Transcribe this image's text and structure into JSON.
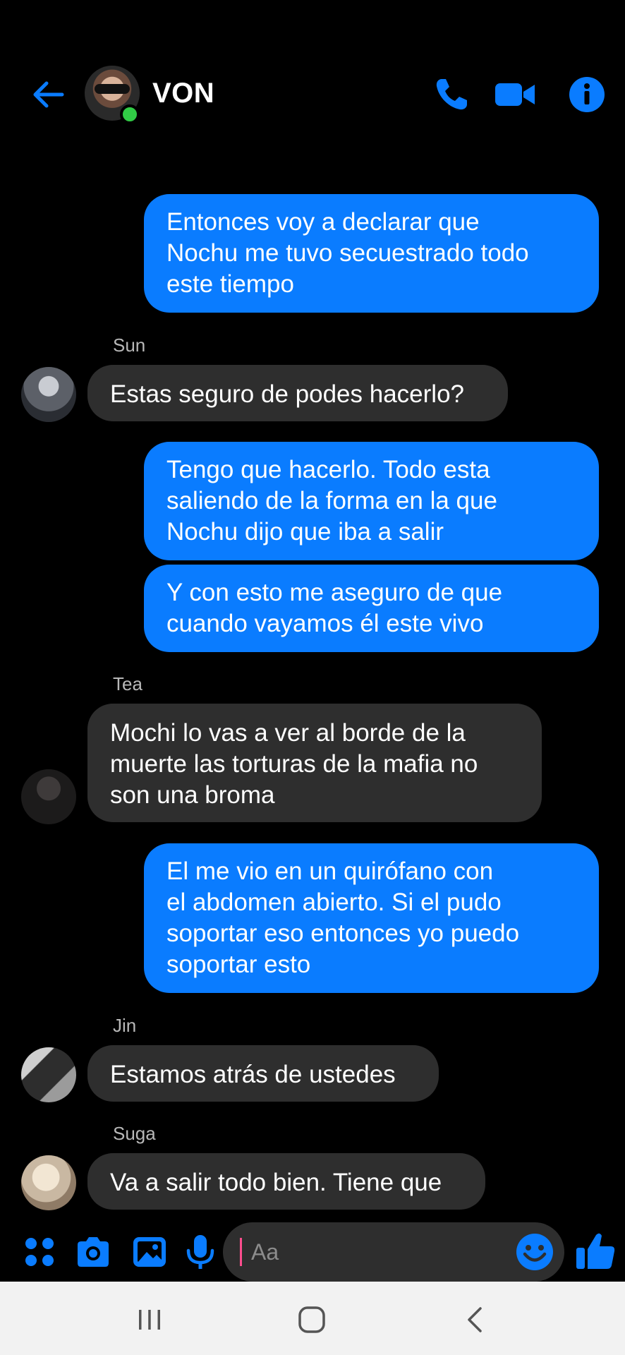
{
  "header": {
    "title": "VON",
    "accent": "#0a7cff",
    "online_color": "#31cc46"
  },
  "messages": [
    {
      "from": "me",
      "lines": [
        "Entonces voy a declarar que",
        "Nochu me tuvo secuestrado todo",
        "este tiempo"
      ]
    },
    {
      "from": "Sun",
      "sender_label": "Sun",
      "lines": [
        "Estas seguro de podes hacerlo?"
      ]
    },
    {
      "from": "me",
      "lines": [
        "Tengo que hacerlo. Todo esta",
        "saliendo de la forma en la que",
        "Nochu dijo que iba a salir"
      ]
    },
    {
      "from": "me",
      "lines": [
        "Y con esto me aseguro de que",
        "cuando vayamos él este vivo"
      ]
    },
    {
      "from": "Tea",
      "sender_label": "Tea",
      "lines": [
        "Mochi lo vas a ver al borde de la",
        "muerte las torturas de la mafia no",
        "son una broma"
      ]
    },
    {
      "from": "me",
      "lines": [
        "El me vio en un quirófano con",
        "el abdomen abierto. Si el pudo",
        "soportar eso entonces yo puedo",
        "soportar esto"
      ]
    },
    {
      "from": "Jin",
      "sender_label": "Jin",
      "lines": [
        "Estamos atrás de ustedes"
      ]
    },
    {
      "from": "Suga",
      "sender_label": "Suga",
      "lines": [
        "Va a salir todo bien. Tiene que"
      ]
    }
  ],
  "composer": {
    "placeholder": "Aa",
    "icons": [
      "apps-icon",
      "camera-icon",
      "gallery-icon",
      "microphone-icon",
      "emoji-icon",
      "thumbs-up-icon"
    ]
  },
  "colors": {
    "outgoing_bubble": "#0a7cff",
    "incoming_bubble": "#2e2e2e",
    "background": "#000000"
  }
}
